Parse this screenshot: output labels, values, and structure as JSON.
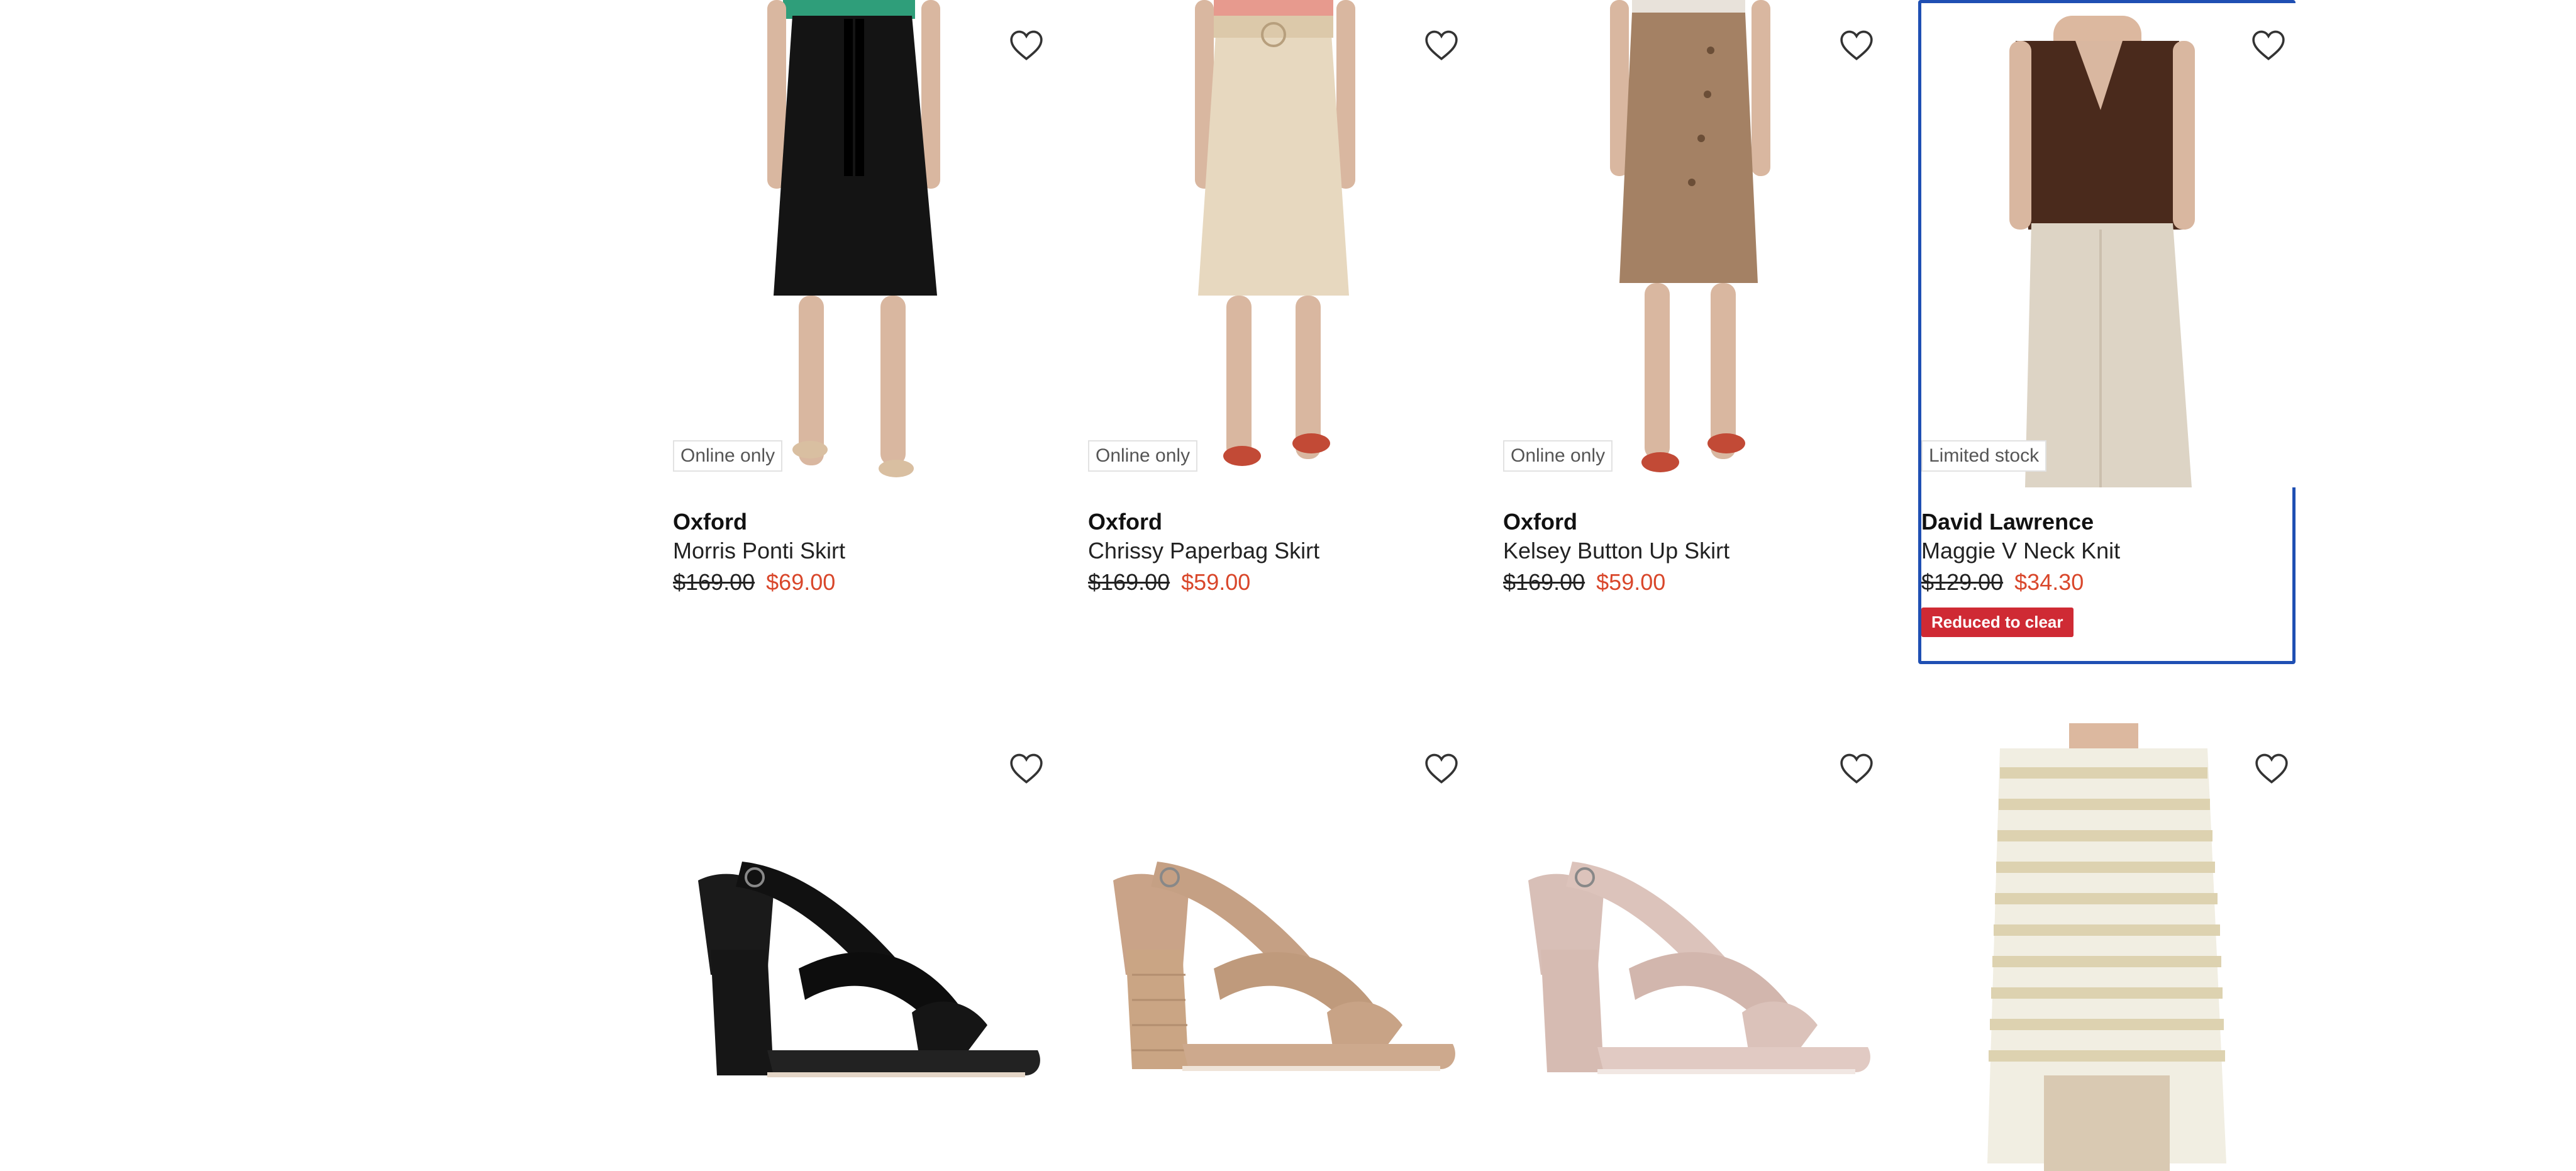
{
  "products": [
    {
      "badge": "Online only",
      "brand": "Oxford",
      "name": "Morris Ponti Skirt",
      "was": "$169.00",
      "now": "$69.00",
      "icon": "heart-outline-icon"
    },
    {
      "badge": "Online only",
      "brand": "Oxford",
      "name": "Chrissy Paperbag Skirt",
      "was": "$169.00",
      "now": "$59.00",
      "icon": "heart-outline-icon"
    },
    {
      "badge": "Online only",
      "brand": "Oxford",
      "name": "Kelsey Button Up Skirt",
      "was": "$169.00",
      "now": "$59.00",
      "icon": "heart-outline-icon"
    },
    {
      "badge": "Limited stock",
      "brand": "David Lawrence",
      "name": "Maggie V Neck Knit",
      "was": "$129.00",
      "now": "$34.30",
      "tag": "Reduced to clear",
      "icon": "heart-outline-icon"
    },
    {
      "icon": "heart-outline-icon"
    },
    {
      "icon": "heart-outline-icon"
    },
    {
      "icon": "heart-outline-icon"
    },
    {
      "icon": "heart-outline-icon"
    }
  ],
  "colors": {
    "sale_price": "#d9472b",
    "focus_outline": "#1f4fb3",
    "clear_tag_bg": "#cf2a34"
  }
}
